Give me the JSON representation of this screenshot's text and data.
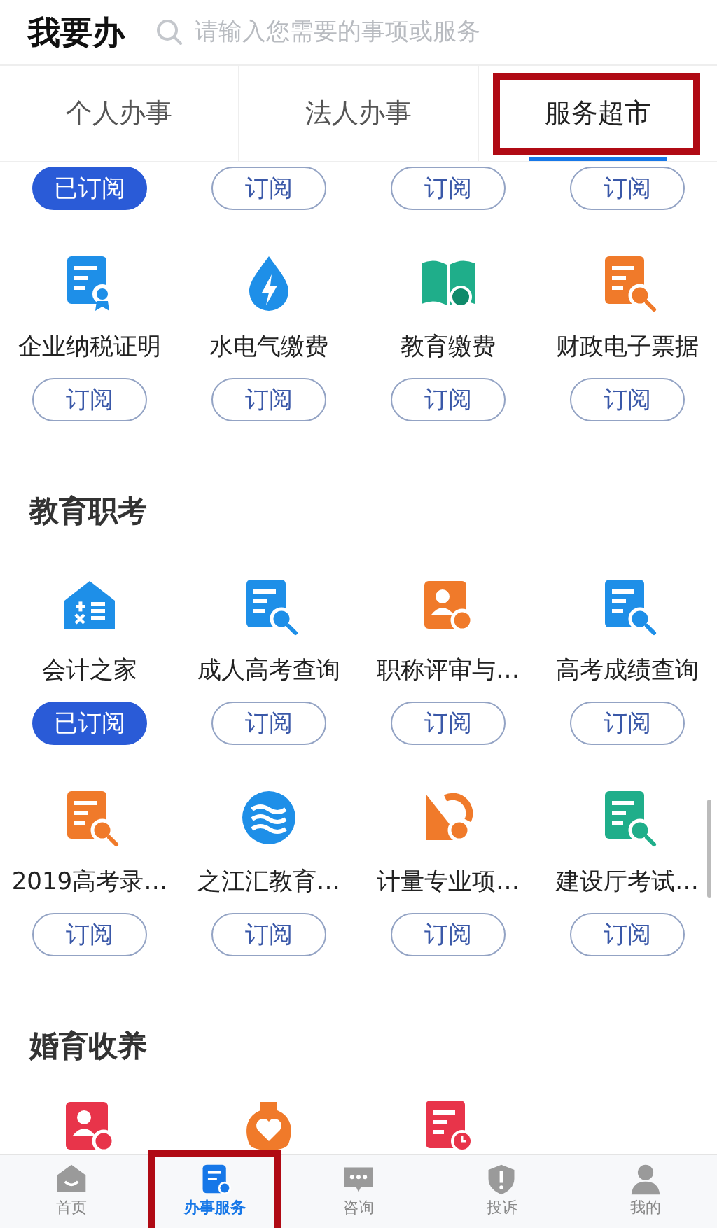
{
  "header": {
    "title": "我要办",
    "search": {
      "placeholder": "请输入您需要的事项或服务"
    }
  },
  "tabs": [
    {
      "label": "个人办事",
      "selected": false,
      "highlighted": false
    },
    {
      "label": "法人办事",
      "selected": false,
      "highlighted": false
    },
    {
      "label": "服务超市",
      "selected": true,
      "highlighted": true
    }
  ],
  "sections": [
    {
      "items": [
        {
          "kind": "button_only",
          "button": "已订阅",
          "subscribed": true
        },
        {
          "kind": "button_only",
          "button": "订阅",
          "subscribed": false
        },
        {
          "kind": "button_only",
          "button": "订阅",
          "subscribed": false
        },
        {
          "kind": "button_only",
          "button": "订阅",
          "subscribed": false
        },
        {
          "kind": "service",
          "label": "企业纳税证明",
          "button": "订阅",
          "subscribed": false
        },
        {
          "kind": "service",
          "label": "水电气缴费",
          "button": "订阅",
          "subscribed": false
        },
        {
          "kind": "service",
          "label": "教育缴费",
          "button": "订阅",
          "subscribed": false
        },
        {
          "kind": "service",
          "label": "财政电子票据",
          "button": "订阅",
          "subscribed": false
        }
      ]
    },
    {
      "title": "教育职考",
      "items": [
        {
          "kind": "service",
          "label": "会计之家",
          "button": "已订阅",
          "subscribed": true
        },
        {
          "kind": "service",
          "label": "成人高考查询",
          "button": "订阅",
          "subscribed": false
        },
        {
          "kind": "service",
          "label": "职称评审与…",
          "button": "订阅",
          "subscribed": false
        },
        {
          "kind": "service",
          "label": "高考成绩查询",
          "button": "订阅",
          "subscribed": false
        },
        {
          "kind": "service",
          "label": "2019高考录…",
          "button": "订阅",
          "subscribed": false
        },
        {
          "kind": "service",
          "label": "之江汇教育…",
          "button": "订阅",
          "subscribed": false
        },
        {
          "kind": "service",
          "label": "计量专业项…",
          "button": "订阅",
          "subscribed": false
        },
        {
          "kind": "service",
          "label": "建设厅考试…",
          "button": "订阅",
          "subscribed": false
        }
      ]
    },
    {
      "title": "婚育收养",
      "items": [
        {
          "kind": "icon_only"
        },
        {
          "kind": "icon_only"
        },
        {
          "kind": "icon_only"
        }
      ]
    }
  ],
  "nav": [
    {
      "label": "首页",
      "selected": false,
      "highlighted": false
    },
    {
      "label": "办事服务",
      "selected": true,
      "highlighted": true
    },
    {
      "label": "咨询",
      "selected": false,
      "highlighted": false
    },
    {
      "label": "投诉",
      "selected": false,
      "highlighted": false
    },
    {
      "label": "我的",
      "selected": false,
      "highlighted": false
    }
  ]
}
